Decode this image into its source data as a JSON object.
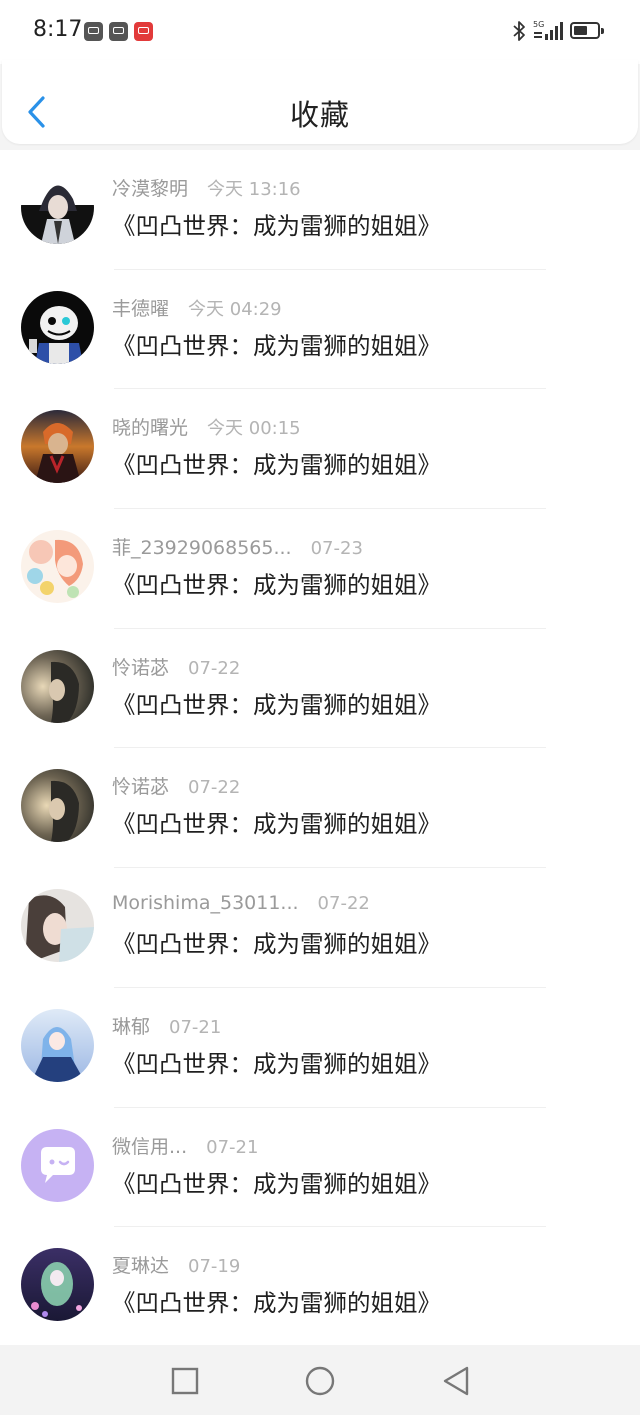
{
  "status_bar": {
    "time": "8:17",
    "notification_icons": [
      "message-icon",
      "message-icon",
      "app-notification-icon"
    ],
    "right_icons": [
      "bluetooth-icon",
      "5g-signal-icon",
      "battery-icon"
    ]
  },
  "header": {
    "title": "收藏",
    "back_icon": "chevron-left-icon",
    "accent_color": "#2a91e8"
  },
  "favorites": [
    {
      "name": "冷漠黎明",
      "time": "今天 13:16",
      "title": "《凹凸世界：成为雷狮的姐姐》"
    },
    {
      "name": "丰德曜",
      "time": "今天 04:29",
      "title": "《凹凸世界：成为雷狮的姐姐》"
    },
    {
      "name": "晓的曙光",
      "time": "今天 00:15",
      "title": "《凹凸世界：成为雷狮的姐姐》"
    },
    {
      "name": "菲_23929068565...",
      "time": "07-23",
      "title": "《凹凸世界：成为雷狮的姐姐》"
    },
    {
      "name": "怜诺苾",
      "time": "07-22",
      "title": "《凹凸世界：成为雷狮的姐姐》"
    },
    {
      "name": "怜诺苾",
      "time": "07-22",
      "title": "《凹凸世界：成为雷狮的姐姐》"
    },
    {
      "name": "Morishima_53011...",
      "time": "07-22",
      "title": "《凹凸世界：成为雷狮的姐姐》"
    },
    {
      "name": "琳郁",
      "time": "07-21",
      "title": "《凹凸世界：成为雷狮的姐姐》"
    },
    {
      "name": "微信用...",
      "time": "07-21",
      "title": "《凹凸世界：成为雷狮的姐姐》"
    },
    {
      "name": "夏琳达",
      "time": "07-19",
      "title": "《凹凸世界：成为雷狮的姐姐》"
    }
  ],
  "nav_bar": {
    "buttons": [
      "recent-apps-icon",
      "home-icon",
      "back-icon"
    ]
  }
}
